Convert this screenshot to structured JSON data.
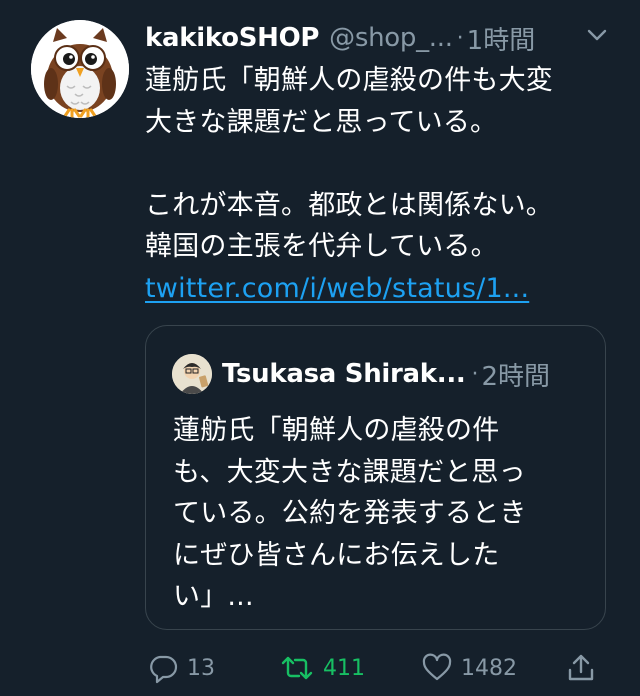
{
  "tweet": {
    "display_name": "kakikoSHOP",
    "handle": "@shop_...",
    "separator": "·",
    "time": "1時間",
    "body_lines": [
      "蓮舫氏「朝鮮人の虐殺の件も大変",
      "大きな課題だと思っている。",
      "",
      "これが本音。都政とは関係ない。",
      "韓国の主張を代弁している。"
    ],
    "link": "twitter.com/i/web/status/1...",
    "icons": {
      "avatar": "owl-avatar",
      "menu": "chevron-down-icon"
    }
  },
  "quoted_tweet": {
    "display_name": "Tsukasa Shirak...",
    "separator": "·",
    "time": "2時間",
    "body_lines": [
      "蓮舫氏「朝鮮人の虐殺の件",
      "も、大変大きな課題だと思っ",
      "ている。公約を発表するとき",
      "にぜひ皆さんにお伝えした",
      "い」..."
    ]
  },
  "actions": {
    "reply_count": "13",
    "retweet_count": "411",
    "like_count": "1482",
    "icons": [
      "reply-icon",
      "retweet-icon",
      "like-icon",
      "share-icon"
    ]
  },
  "colors": {
    "background": "#15202b",
    "text": "#ffffff",
    "secondary": "#8899a6",
    "link": "#1da1f2",
    "retweet_active": "#17bf63",
    "border": "#38444d"
  }
}
